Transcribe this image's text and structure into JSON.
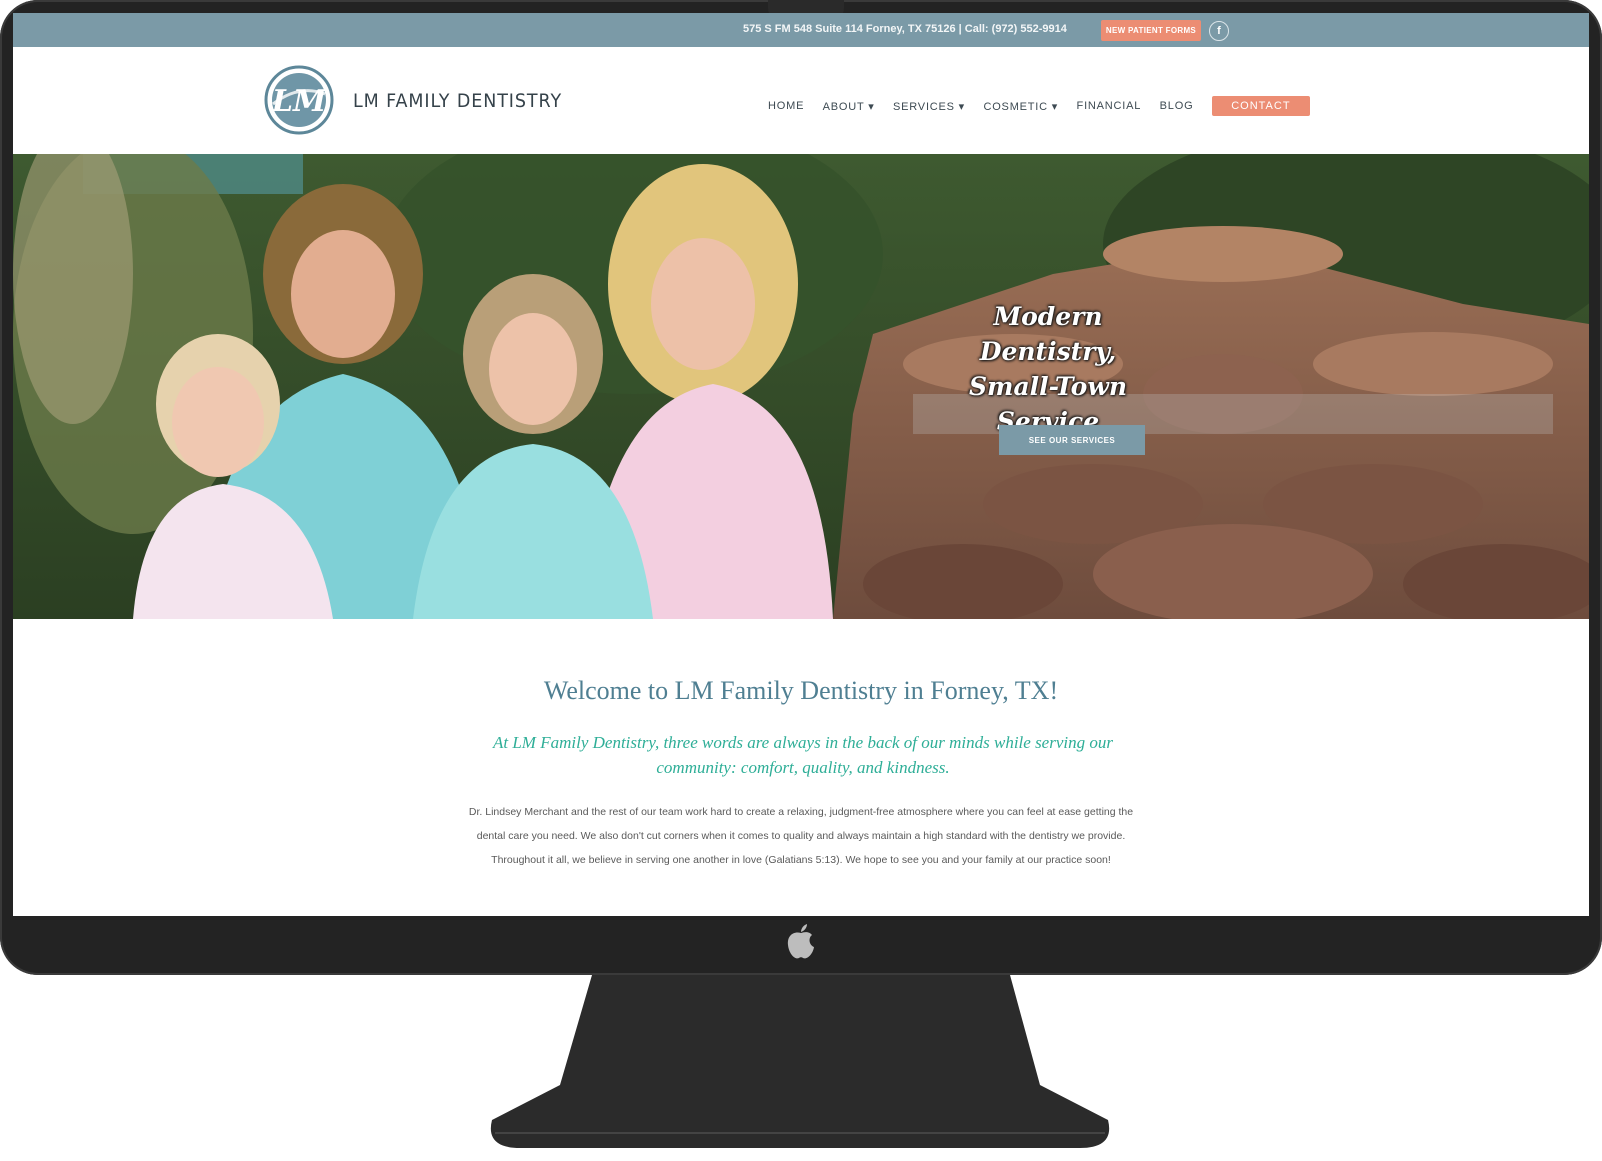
{
  "topbar": {
    "contact_line": "575 S FM 548 Suite 114 Forney, TX 75126 | Call: (972) 552-9914",
    "new_patient_label": "New Patient Forms",
    "facebook_glyph": "f",
    "background": "#7b9aa7",
    "button_color": "#ec8d73"
  },
  "header": {
    "logo_initials": "LM",
    "logo_text": "LM FAMILY DENTISTRY",
    "nav": [
      {
        "label": "HOME"
      },
      {
        "label": "ABOUT ▾"
      },
      {
        "label": "SERVICES ▾"
      },
      {
        "label": "COSMETIC ▾"
      },
      {
        "label": "FINANCIAL"
      },
      {
        "label": "BLOG"
      }
    ],
    "contact_label": "CONTACT"
  },
  "hero": {
    "headline_line1": "Modern Dentistry,",
    "headline_line2": "Small-Town",
    "headline_line3": "Service",
    "cta_label": "See Our Services"
  },
  "content": {
    "welcome_title": "Welcome to LM Family Dentistry in Forney, TX!",
    "tagline": "At LM Family Dentistry, three words are always in the back of our minds while serving our community: comfort, quality, and kindness.",
    "body": "Dr. Lindsey Merchant and the rest of our team work hard to create a relaxing, judgment-free atmosphere where you can feel at ease getting the dental care you need. We also don't cut corners when it comes to quality and always maintain a high standard with the dentistry we provide. Throughout it all, we believe in serving one another in love (Galatians 5:13). We hope to see you and your family at our practice soon!",
    "title_color": "#4f7f92",
    "tagline_color": "#2eae97"
  },
  "icons": {
    "device": "imac-monitor",
    "chin": "apple-logo-icon",
    "social": "facebook-icon"
  }
}
